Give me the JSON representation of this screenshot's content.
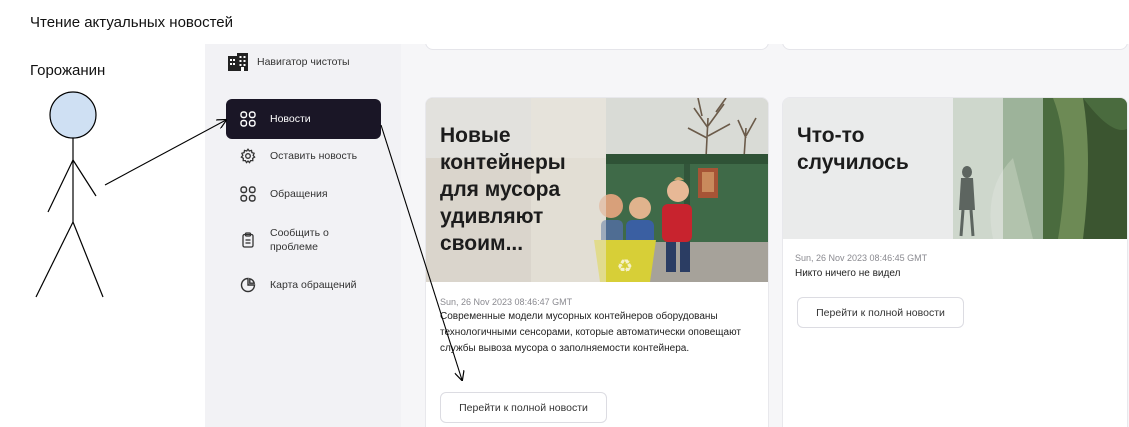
{
  "diagram": {
    "title": "Чтение актуальных новостей",
    "actor": "Горожанин"
  },
  "app": {
    "brand": {
      "name": "Навигатор чистоты",
      "icon": "building-icon"
    },
    "nav": [
      {
        "label": "Новости",
        "icon": "grid-icon",
        "active": true
      },
      {
        "label": "Оставить новость",
        "icon": "gear-icon",
        "active": false
      },
      {
        "label": "Обращения",
        "icon": "grid-icon",
        "active": false
      },
      {
        "label": "Сообщить о проблеме",
        "icon": "clipboard-icon",
        "active": false
      },
      {
        "label": "Карта обращений",
        "icon": "pie-chart-icon",
        "active": false
      }
    ],
    "news": [
      {
        "headline": "Новые контейнеры для мусора удивляют своим...",
        "date": "Sun, 26 Nov 2023 08:46:47 GMT",
        "text": "Современные модели мусорных контейнеров оборудованы технологичными сенсорами, которые автоматически оповещают службы вывоза мусора о заполняемости контейнера.",
        "button": "Перейти к полной новости"
      },
      {
        "headline": "Что-то случилось",
        "date": "Sun, 26 Nov 2023 08:46:45 GMT",
        "text": "Никто ничего не видел",
        "button": "Перейти к полной новости"
      }
    ]
  }
}
